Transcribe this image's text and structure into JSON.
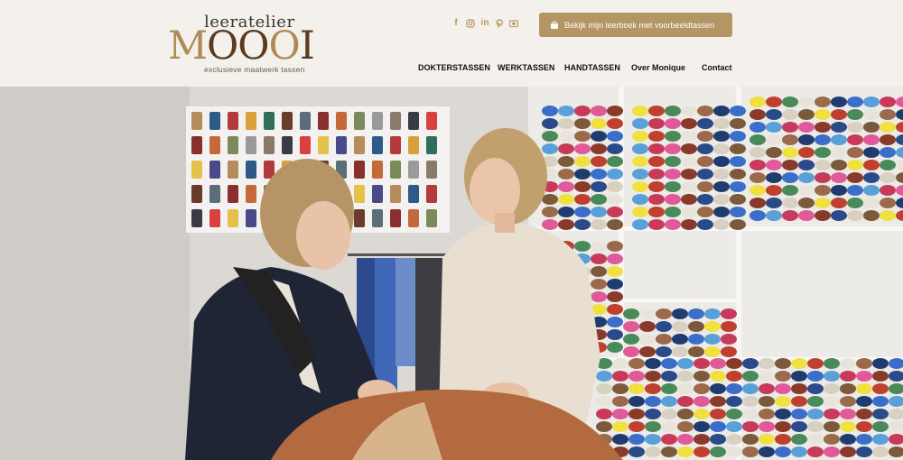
{
  "header": {
    "logo": {
      "line1": "leeratelier",
      "word": "MOOOI",
      "tagline": "exclusieve maatwerk tassen"
    },
    "social_icons": [
      "facebook-icon",
      "instagram-icon",
      "linkedin-icon",
      "pinterest-icon",
      "camera-icon"
    ],
    "cta_label": "Bekijk mijn leerboek met voorbeeldtassen",
    "nav": [
      {
        "label": "DOKTERSTASSEN"
      },
      {
        "label": "WERKTASSEN"
      },
      {
        "label": "HANDTASSEN"
      },
      {
        "label": "Over Monique"
      },
      {
        "label": "Contact"
      }
    ]
  },
  "colors": {
    "background": "#f4f1ec",
    "accent": "#b39664",
    "logo_gold": "#b08a55",
    "logo_brown": "#5b3a20"
  },
  "hero": {
    "image": "photo-two-women-with-leather-in-workshop"
  }
}
